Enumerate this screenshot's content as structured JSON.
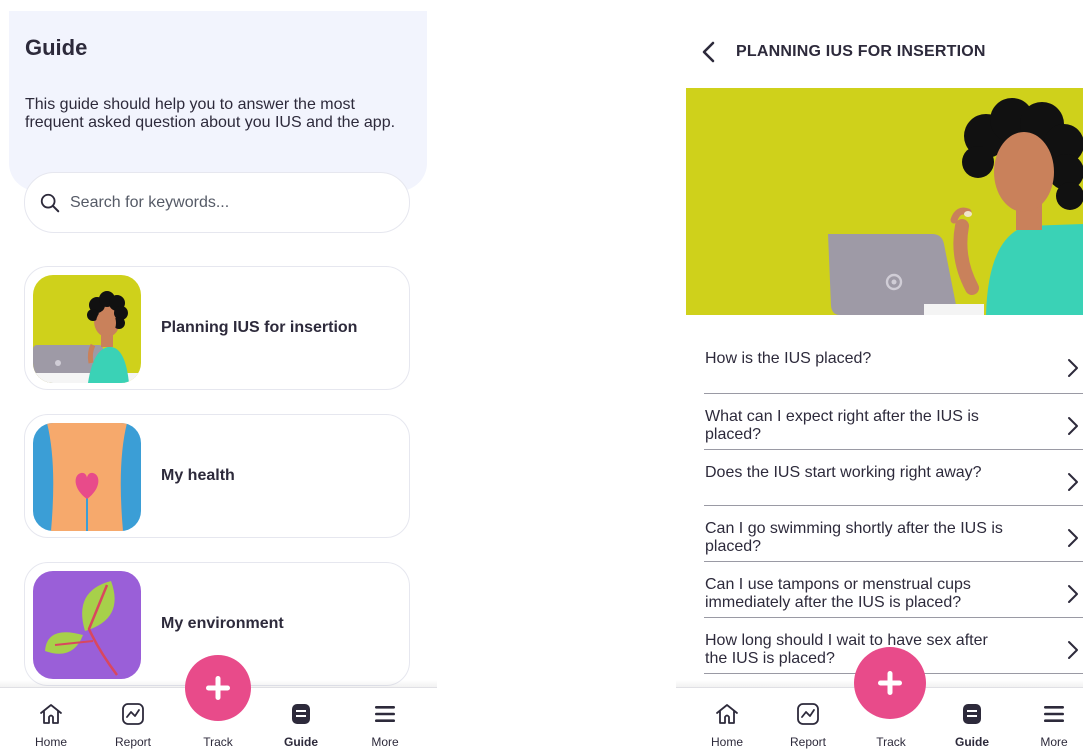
{
  "left": {
    "title": "Guide",
    "description": "This guide should help you to answer the most frequent asked question about you IUS and the app.",
    "search": {
      "placeholder": "Search for keywords..."
    },
    "cards": [
      {
        "label": "Planning IUS for insertion",
        "icon": "woman-laptop-illustration"
      },
      {
        "label": "My health",
        "icon": "body-heart-illustration"
      },
      {
        "label": "My environment",
        "icon": "leaf-illustration"
      }
    ]
  },
  "right": {
    "title": "PLANNING IUS FOR INSERTION",
    "questions": [
      "How is the IUS placed?",
      "What can I expect right after the IUS is placed?",
      "Does the IUS start working right away?",
      "Can I go swimming shortly after the IUS is placed?",
      "Can I use tampons or menstrual cups immediately after the IUS is placed?",
      "How long should I wait to have sex after the IUS is placed?"
    ]
  },
  "nav": {
    "items": [
      {
        "label": "Home",
        "icon": "home-icon"
      },
      {
        "label": "Report",
        "icon": "report-icon"
      },
      {
        "label": "Track",
        "icon": "plus-icon"
      },
      {
        "label": "Guide",
        "icon": "guide-icon",
        "active": true
      },
      {
        "label": "More",
        "icon": "menu-icon"
      }
    ]
  },
  "colors": {
    "header_bg": "#f2f4fd",
    "accent_pink": "#e84b8a",
    "hero_yellow": "#cfd11b",
    "text_dark": "#2d2a3b"
  }
}
